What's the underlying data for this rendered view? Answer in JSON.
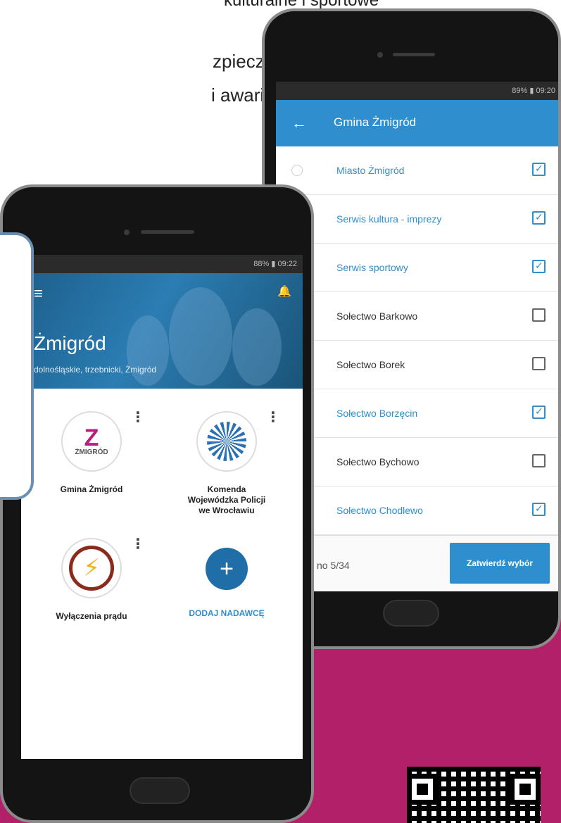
{
  "poster": {
    "line0": "kulturalne i sportowe",
    "line1": "zpieczeństwa",
    "line2": "i awarie"
  },
  "back_phone": {
    "status": "89% ▮ 09:20",
    "appbar": {
      "back_icon": "arrow-left-icon",
      "title": "Gmina Żmigród"
    },
    "items": [
      {
        "label": "Miasto Żmigród",
        "checked": true
      },
      {
        "label": "Serwis kultura - imprezy",
        "checked": true
      },
      {
        "label": "Serwis sportowy",
        "checked": true
      },
      {
        "label": "Sołectwo Barkowo",
        "checked": false
      },
      {
        "label": "Sołectwo Borek",
        "checked": false
      },
      {
        "label": "Sołectwo Borzęcin",
        "checked": true
      },
      {
        "label": "Sołectwo Bychowo",
        "checked": false
      },
      {
        "label": "Sołectwo Chodlewo",
        "checked": true
      }
    ],
    "footer": {
      "count": "no 5/34",
      "confirm_label": "Zatwierdź wybór"
    }
  },
  "front_phone": {
    "status": "88% ▮ 09:22",
    "hero": {
      "menu_icon": "menu-icon",
      "bell_icon": "bell-icon",
      "city": "Żmigród",
      "region": "dolnośląskie, trzebnicki, Żmigród"
    },
    "senders": [
      {
        "name": "Gmina Żmigród",
        "logo_text": "ŻMIGRÓD"
      },
      {
        "name": "Komenda Wojewódzka Policji we Wrocławiu"
      },
      {
        "name": "Wyłączenia prądu"
      }
    ],
    "add_sender": {
      "icon": "+",
      "label": "DODAJ NADAWCĘ"
    }
  },
  "colors": {
    "primary": "#2f8fce",
    "magenta": "#b12068",
    "yellow": "#f2e21c"
  }
}
